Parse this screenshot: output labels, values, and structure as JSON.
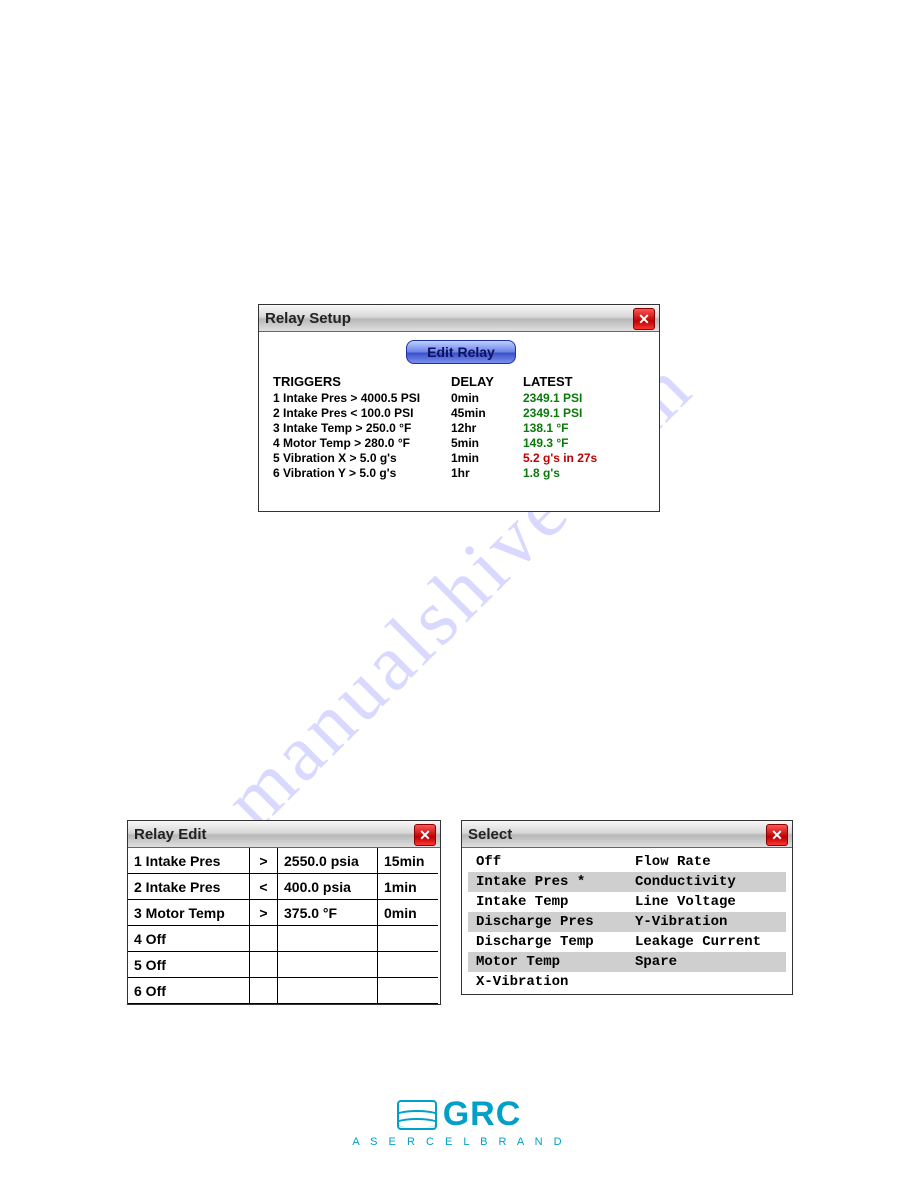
{
  "watermark": "manualshive.com",
  "relay_setup": {
    "title": "Relay Setup",
    "edit_btn": "Edit Relay",
    "head_trig": "TRIGGERS",
    "head_delay": "DELAY",
    "head_latest": "LATEST",
    "rows": [
      {
        "trig": "1 Intake Pres > 4000.5 PSI",
        "delay": "0min",
        "latest": "2349.1 PSI",
        "status": "green"
      },
      {
        "trig": "2 Intake Pres < 100.0 PSI",
        "delay": "45min",
        "latest": "2349.1 PSI",
        "status": "green"
      },
      {
        "trig": "3 Intake Temp > 250.0 °F",
        "delay": "12hr",
        "latest": "138.1 °F",
        "status": "green"
      },
      {
        "trig": "4 Motor Temp > 280.0 °F",
        "delay": "5min",
        "latest": "149.3 °F",
        "status": "green"
      },
      {
        "trig": "5 Vibration X > 5.0 g's",
        "delay": "1min",
        "latest": "5.2 g's in 27s",
        "status": "red"
      },
      {
        "trig": "6 Vibration Y > 5.0 g's",
        "delay": "1hr",
        "latest": "1.8 g's",
        "status": "green"
      }
    ]
  },
  "relay_edit": {
    "title": "Relay Edit",
    "rows": [
      {
        "name": "1 Intake Pres",
        "op": ">",
        "val": "2550.0 psia",
        "delay": "15min"
      },
      {
        "name": "2 Intake Pres",
        "op": "<",
        "val": "400.0 psia",
        "delay": "1min"
      },
      {
        "name": "3 Motor Temp",
        "op": ">",
        "val": "375.0 °F",
        "delay": "0min"
      },
      {
        "name": "4 Off",
        "op": "",
        "val": "",
        "delay": ""
      },
      {
        "name": "5 Off",
        "op": "",
        "val": "",
        "delay": ""
      },
      {
        "name": "6 Off",
        "op": "",
        "val": "",
        "delay": ""
      }
    ]
  },
  "select": {
    "title": "Select",
    "col1": [
      "Off",
      "Intake Pres *",
      "Intake Temp",
      "Discharge Pres",
      "Discharge Temp",
      "Motor Temp",
      "X-Vibration"
    ],
    "col2": [
      "Flow Rate",
      "Conductivity",
      "Line Voltage",
      "Y-Vibration",
      "Leakage Current",
      "Spare"
    ]
  },
  "footer": {
    "brand": "GRC",
    "tagline": "A  S E R C E L  B R A N D"
  }
}
